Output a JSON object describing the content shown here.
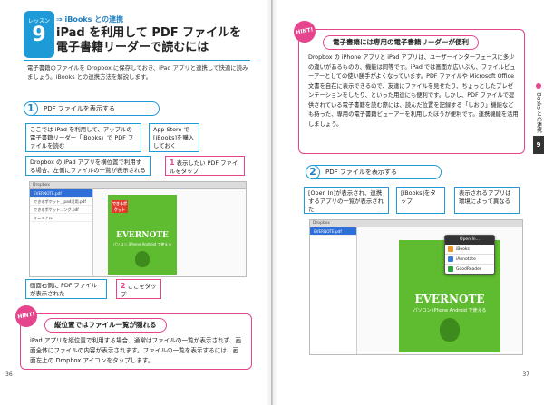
{
  "left": {
    "lesson": {
      "label": "レッスン",
      "number": "9"
    },
    "subtitle": "⇒ iBooks との連携",
    "title_line1": "iPad を利用して PDF ファイルを",
    "title_line2": "電子書籍リーダーで読むには",
    "intro": "電子書籍のファイルを Dropbox に保存しておき、iPad アプリと連携して快適に読みましょう。iBooks との連携方法を解説します。",
    "step1": {
      "number": "1",
      "title": "PDF ファイルを表示する"
    },
    "callouts": {
      "ipad_app": "ここでは iPad を利用して、アップルの電子書籍リーダー「iBooks」で PDF ファイルを読む",
      "appstore": "App Store で[iBooks]を購入しておく",
      "landscape": "Dropbox の iPad アプリを横位置で利用する場合、左側にファイルの一覧が表示される",
      "tap1_num": "1",
      "tap1": "表示したい PDF ファイルをタップ",
      "preview": "画面右側に PDF ファイルが表示された",
      "tap2_num": "2",
      "tap2": "ここをタップ"
    },
    "screenshot": {
      "bar": "Dropbox",
      "rows": [
        "EVERNOTE.pdf",
        "できるポケット＿pad活用.pdf",
        "できるポケット...ング.pdf",
        "マニュアル"
      ],
      "doc_tag": "できるポケット",
      "doc_logo": "EVERNOTE",
      "doc_sub": "パソコン iPhone Android で使える"
    },
    "hint": {
      "icon": "HINT!",
      "title": "縦位置ではファイル一覧が隠れる",
      "body": "iPad アプリを縦位置で利用する場合、通常はファイルの一覧が表示されず、画面全体にファイルの内容が表示されます。ファイルの一覧を表示するには、画面左上の Dropbox アイコンをタップします。"
    },
    "page_number": "36"
  },
  "right": {
    "hint": {
      "icon": "HINT!",
      "title": "電子書籍には専用の電子書籍リーダーが便利",
      "body": "Dropbox の iPhone アプリと iPad アプリは、ユーザーインターフェースに多少の違いがあるものの、機能は同等です。iPad では画面が広いぶん、ファイルビューアーとしての使い勝手がよくなっています。PDF ファイルや Microsoft Office 文書を自在に表示できるので、友達にファイルを見せたり、ちょっとしたプレゼンテーションをしたり、といった用途にも便利です。しかし、PDF ファイルで提供されている電子書籍を読む際には、読んだ位置を記録する「しおり」機能なども持った、専用の電子書籍ビューアーを利用したほうが便利です。連携機能を活用しましょう。"
    },
    "step2": {
      "number": "2",
      "title": "PDF ファイルを表示する"
    },
    "callouts": {
      "open_in": "[Open In]が表示され、連携するアプリの一覧が表示された",
      "ibooks": "[iBooks]をタップ",
      "apps_vary": "表示されるアプリは環境によって異なる"
    },
    "screenshot": {
      "bar": "Dropbox",
      "rows": [
        "EVERNOTE.pdf"
      ],
      "popup_title": "Open In...",
      "popup_items": [
        "iBooks",
        "iAnnotate",
        "GoodReader"
      ],
      "doc_logo": "EVERNOTE",
      "doc_sub": "パソコン iPhone Android で使える"
    },
    "side_tab": "iBooks との連携",
    "side_num": "9",
    "page_number": "37"
  }
}
